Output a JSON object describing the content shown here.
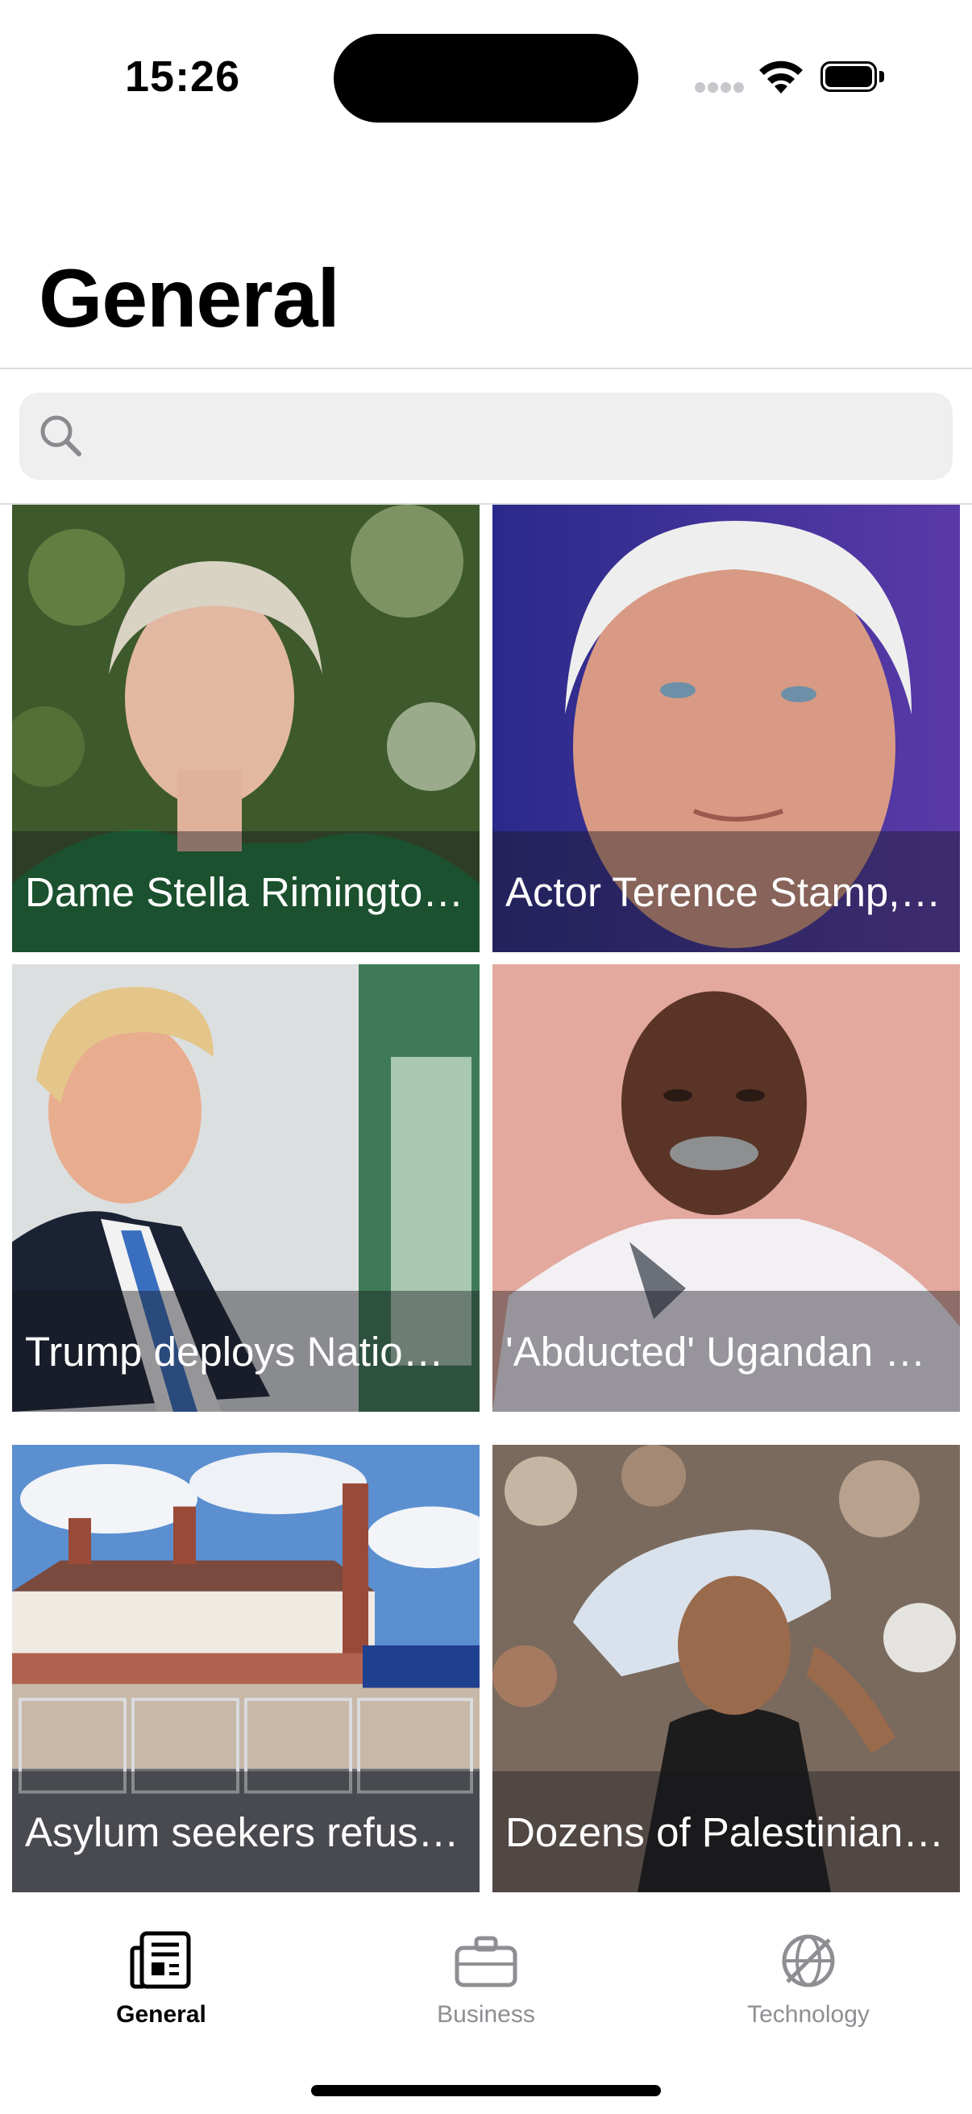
{
  "status_bar": {
    "time": "15:26"
  },
  "header": {
    "title": "General"
  },
  "search": {
    "placeholder": ""
  },
  "articles": [
    {
      "caption": "Dame Stella Rimington,…",
      "image": "portrait-woman-green-background"
    },
    {
      "caption": "Actor Terence Stamp,…",
      "image": "portrait-man-purple-background"
    },
    {
      "caption": "Trump deploys National…",
      "image": "portrait-man-suit-blue-tie"
    },
    {
      "caption": "'Abducted' Ugandan un…",
      "image": "portrait-man-pink-background"
    },
    {
      "caption": "Asylum seekers refusin…",
      "image": "hotel-building-with-fences"
    },
    {
      "caption": "Dozens of Palestinians…",
      "image": "man-carrying-flour-sack"
    }
  ],
  "tabbar": {
    "tabs": [
      {
        "label": "General",
        "icon": "newspaper-icon",
        "active": true
      },
      {
        "label": "Business",
        "icon": "briefcase-icon",
        "active": false
      },
      {
        "label": "Technology",
        "icon": "globe-slash-icon",
        "active": false
      }
    ]
  },
  "colors": {
    "active_tab": "#000000",
    "inactive_tab": "#8e8e93",
    "search_bg": "#efefef"
  }
}
